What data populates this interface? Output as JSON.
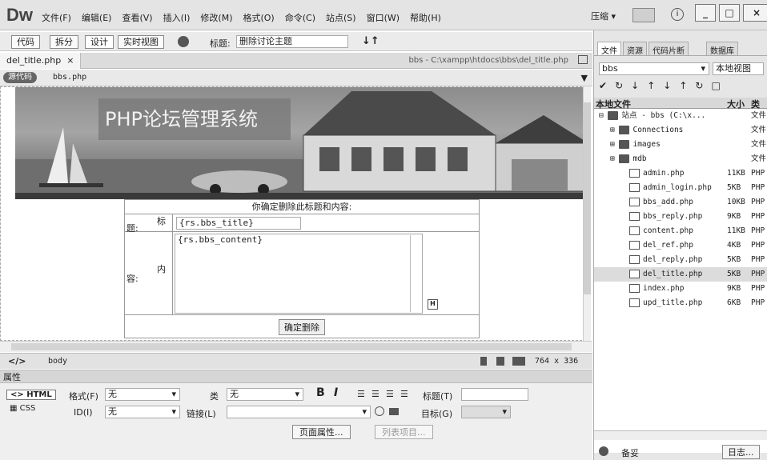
{
  "app": {
    "logo": "Dw",
    "menus": [
      "文件(F)",
      "编辑(E)",
      "查看(V)",
      "插入(I)",
      "修改(M)",
      "格式(O)",
      "命令(C)",
      "站点(S)",
      "窗口(W)",
      "帮助(H)"
    ],
    "compress": "压缩",
    "window_buttons": [
      "_",
      "□",
      "×"
    ]
  },
  "toolbar": {
    "code": "代码",
    "split": "拆分",
    "design": "设计",
    "live": "实时视图",
    "title_label": "标题:",
    "title_value": "删除讨论主题"
  },
  "doc": {
    "tab": "del_title.php",
    "tab_close": "×",
    "path": "bbs - C:\\xampp\\htdocs\\bbs\\del_title.php",
    "source_badge": "源代码",
    "source_file": "bbs.php"
  },
  "design": {
    "banner_title": "PHP论坛管理系统",
    "prompt": "你确定删除此标题和内容:",
    "title_label_top": "标",
    "title_label_bottom": "题:",
    "title_value": "{rs.bbs_title}",
    "content_label_top": "内",
    "content_label_bottom": "容:",
    "content_value": "{rs.bbs_content}",
    "submit": "确定删除"
  },
  "status": {
    "tag_html": "</>",
    "tag_body": "body",
    "size": "764 x 336"
  },
  "props": {
    "header": "属性",
    "html_btn": "<> HTML",
    "css_btn": "CSS",
    "format_label": "格式(F)",
    "format_value": "无",
    "class_label": "类",
    "class_value": "无",
    "bold": "B",
    "italic": "I",
    "title_label": "标题(T)",
    "id_label": "ID(I)",
    "id_value": "无",
    "link_label": "链接(L)",
    "target_label": "目标(G)",
    "page_props": "页面属性...",
    "list_item": "列表项目..."
  },
  "right_panel": {
    "tabs": [
      "文件",
      "资源",
      "代码片断",
      "数据库"
    ],
    "site": "bbs",
    "view": "本地视图",
    "col_name": "本地文件",
    "col_size": "大小",
    "col_type": "类型",
    "rows": [
      {
        "name": "站点 - bbs (C:\\x...",
        "size": "",
        "type": "文件",
        "kind": "site"
      },
      {
        "name": "Connections",
        "size": "",
        "type": "文件",
        "kind": "folder"
      },
      {
        "name": "images",
        "size": "",
        "type": "文件",
        "kind": "folder"
      },
      {
        "name": "mdb",
        "size": "",
        "type": "文件",
        "kind": "folder"
      },
      {
        "name": "admin.php",
        "size": "11KB",
        "type": "PHP",
        "kind": "file"
      },
      {
        "name": "admin_login.php",
        "size": "5KB",
        "type": "PHP",
        "kind": "file"
      },
      {
        "name": "bbs_add.php",
        "size": "10KB",
        "type": "PHP",
        "kind": "file"
      },
      {
        "name": "bbs_reply.php",
        "size": "9KB",
        "type": "PHP",
        "kind": "file"
      },
      {
        "name": "content.php",
        "size": "11KB",
        "type": "PHP",
        "kind": "file"
      },
      {
        "name": "del_ref.php",
        "size": "4KB",
        "type": "PHP",
        "kind": "file"
      },
      {
        "name": "del_reply.php",
        "size": "5KB",
        "type": "PHP",
        "kind": "file"
      },
      {
        "name": "del_title.php",
        "size": "5KB",
        "type": "PHP",
        "kind": "file",
        "selected": true
      },
      {
        "name": "index.php",
        "size": "9KB",
        "type": "PHP",
        "kind": "file"
      },
      {
        "name": "upd_title.php",
        "size": "6KB",
        "type": "PHP",
        "kind": "file"
      }
    ],
    "footer_left": "备妥",
    "footer_right": "日志..."
  }
}
